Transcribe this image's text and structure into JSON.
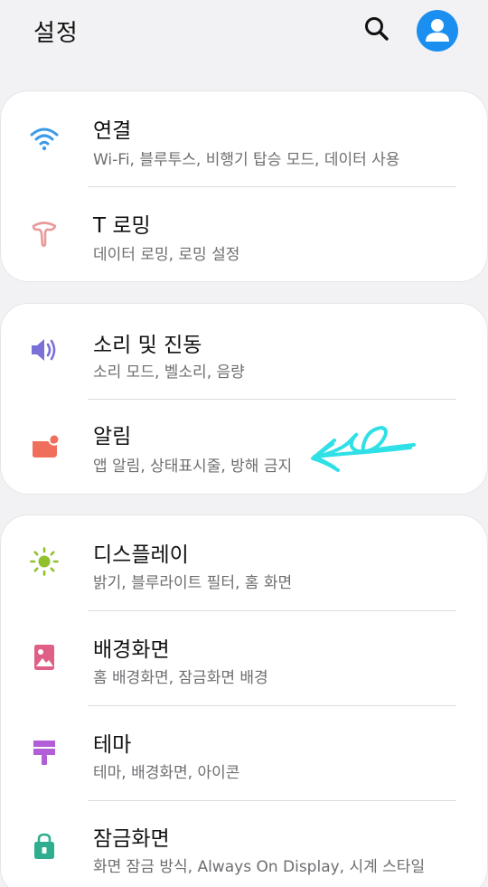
{
  "header": {
    "title": "설정",
    "search_icon": "search-icon",
    "profile_icon": "account-icon",
    "accent_color": "#1a8ff0"
  },
  "groups": [
    {
      "items": [
        {
          "label": "연결",
          "sub": "Wi-Fi, 블루투스, 비행기 탑승 모드, 데이터 사용",
          "icon": "wifi-icon",
          "color": "#3b9ae8"
        },
        {
          "label": "T 로밍",
          "sub": "데이터 로밍, 로밍 설정",
          "icon": "t-roaming-icon",
          "color": "#e89a9a"
        }
      ]
    },
    {
      "items": [
        {
          "label": "소리 및 진동",
          "sub": "소리 모드, 벨소리, 음량",
          "icon": "speaker-icon",
          "color": "#7b6fd8"
        },
        {
          "label": "알림",
          "sub": "앱 알림, 상태표시줄, 방해 금지",
          "icon": "notification-icon",
          "color": "#ef6e5c"
        }
      ]
    },
    {
      "items": [
        {
          "label": "디스플레이",
          "sub": "밝기, 블루라이트 필터, 홈 화면",
          "icon": "brightness-icon",
          "color": "#8fc12d"
        },
        {
          "label": "배경화면",
          "sub": "홈 배경화면, 잠금화면 배경",
          "icon": "wallpaper-icon",
          "color": "#e05f86"
        },
        {
          "label": "테마",
          "sub": "테마, 배경화면, 아이콘",
          "icon": "theme-brush-icon",
          "color": "#b25ed6"
        },
        {
          "label": "잠금화면",
          "sub": "화면 잠금 방식, Always On Display, 시계 스타일",
          "icon": "lock-icon",
          "color": "#2fae8f"
        }
      ]
    }
  ],
  "annotation": {
    "icon": "hand-drawn-arrow",
    "color": "#2fe0e6"
  }
}
